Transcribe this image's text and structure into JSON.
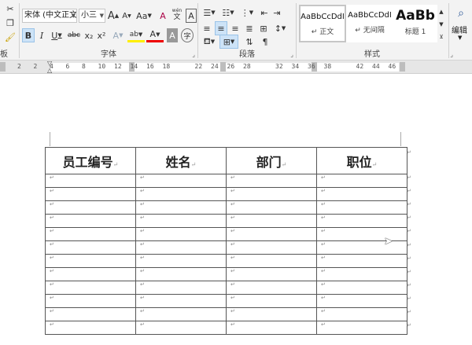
{
  "font": {
    "family": "宋体 (中文正文",
    "size": "小三",
    "grow_glyph": "A",
    "shrink_glyph": "A",
    "case_glyph": "Aa",
    "clear_glyph": "A",
    "phonetic_glyph": "wén",
    "border_char_glyph": "A",
    "bold": "B",
    "italic": "I",
    "underline": "U",
    "strike": "abc",
    "sub": "x₂",
    "sup": "x²",
    "effects": "A",
    "highlight": "ab",
    "color": "A",
    "shading": "A",
    "enclose": "字",
    "label": "字体"
  },
  "paragraph": {
    "label": "段落"
  },
  "styles": {
    "label": "样式",
    "items": [
      {
        "sample": "AaBbCcDdI",
        "name": "↵ 正文"
      },
      {
        "sample": "AaBbCcDdI",
        "name": "↵ 无间隔"
      },
      {
        "sample": "AaBb",
        "name": "标题 1"
      }
    ]
  },
  "edit": {
    "label": "编辑"
  },
  "left_group": {
    "label": "板"
  },
  "ruler": {
    "ticks": [
      "2",
      "2",
      "4",
      "6",
      "8",
      "10",
      "12",
      "14",
      "16",
      "18",
      "",
      "22",
      "24",
      "26",
      "28",
      "",
      "32",
      "34",
      "36",
      "38",
      "",
      "42",
      "44",
      "46"
    ]
  },
  "table": {
    "headers": [
      "员工编号",
      "姓名",
      "部门",
      "职位"
    ],
    "mark": "↵",
    "row_count": 12
  }
}
